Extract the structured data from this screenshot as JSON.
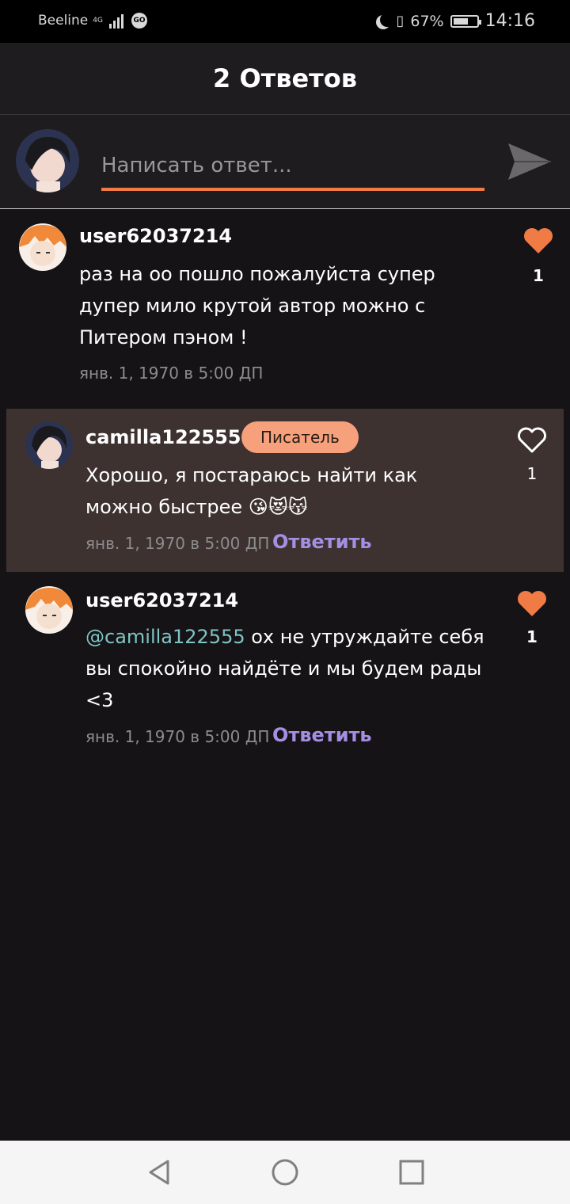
{
  "status_bar": {
    "carrier": "Beeline",
    "network": "4G",
    "go_badge": "GO",
    "battery_percent": "67%",
    "battery_level": 0.67,
    "time": "14:16"
  },
  "header": {
    "title": "2 Ответов"
  },
  "compose": {
    "placeholder": "Написать ответ...",
    "accent_color": "#f07b44"
  },
  "comments": [
    {
      "username": "user62037214",
      "text": "раз на оо пошло пожалуйста супер дупер мило крутой автор можно с Питером пэном !",
      "text_lines": [
        "раз на оо пошло пожалуйста супер",
        "дупер мило крутой автор можно с",
        "Питером пэном !"
      ],
      "timestamp": "янв. 1, 1970 в 5:00 ДП",
      "likes": "1",
      "liked": true
    },
    {
      "username": "camilla122555",
      "badge": "Писатель",
      "text_lines": [
        "Хорошо, я постараюсь найти как",
        "можно быстрее 😘😻😽"
      ],
      "timestamp": "янв. 1, 1970 в 5:00 ДП",
      "reply_label": "Ответить",
      "likes": "1",
      "liked": false,
      "highlighted": true
    },
    {
      "username": "user62037214",
      "mention": "@camilla122555",
      "text_lines": [
        " ох не утруждайте себя",
        "вы спокойно найдёте и мы будем рады",
        "<3"
      ],
      "timestamp": "янв. 1, 1970 в 5:00 ДП",
      "reply_label": "Ответить",
      "likes": "1",
      "liked": true
    }
  ],
  "colors": {
    "like_active": "#f07b44",
    "reply_link": "#a48fe3",
    "mention": "#7fc4c4",
    "badge_bg": "#f7a17c",
    "highlight_bg": "#3d3230"
  },
  "nav": {
    "icons": [
      "back-icon",
      "home-icon",
      "recents-icon"
    ]
  }
}
